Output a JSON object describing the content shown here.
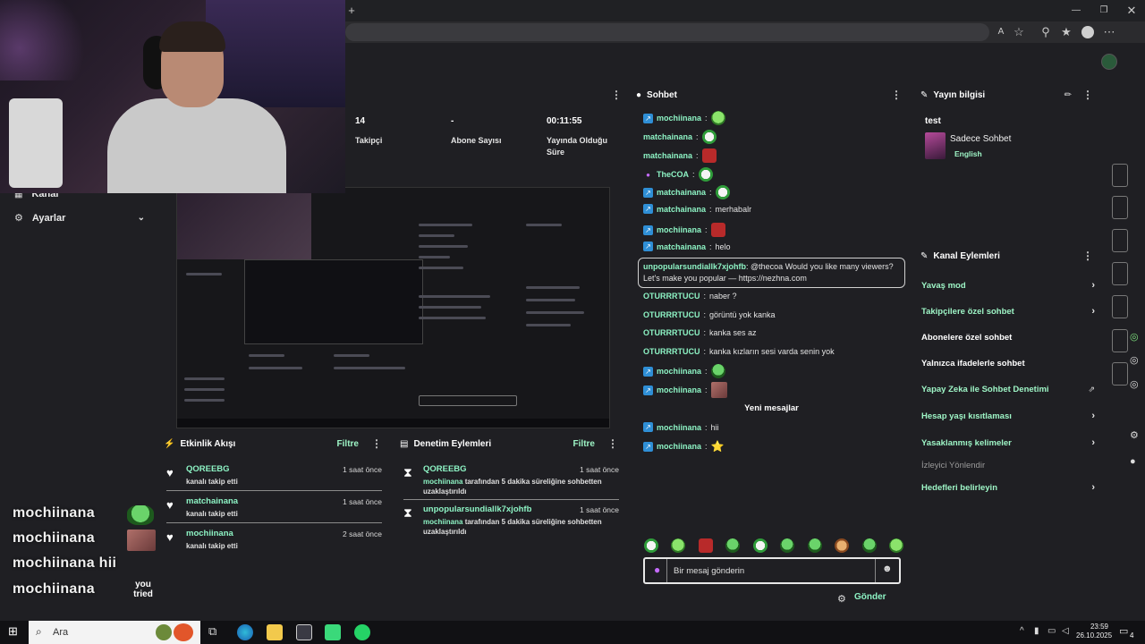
{
  "browser": {
    "new_tab_icon": "plus-icon",
    "window_controls": [
      "minimize-icon",
      "restore-icon",
      "close-icon"
    ]
  },
  "nav": {
    "kanal_label": "Kanal",
    "ayarlar_label": "Ayarlar"
  },
  "stats": {
    "panel_kebab": "⋮",
    "items": [
      {
        "value": "14",
        "label": "Takipçi"
      },
      {
        "value": "-",
        "label": "Abone Sayısı"
      },
      {
        "value": "00:11:55",
        "label": "Yayında Olduğu Süre"
      }
    ]
  },
  "activity": {
    "title": "Etkinlik Akışı",
    "filter": "Filtre",
    "events": [
      {
        "name": "QOREEBG",
        "desc": "kanalı takip etti",
        "time": "1 saat önce"
      },
      {
        "name": "matchainana",
        "desc": "kanalı takip etti",
        "time": "1 saat önce"
      },
      {
        "name": "mochiinana",
        "desc": "kanalı takip etti",
        "time": "2 saat önce"
      }
    ]
  },
  "moderation": {
    "title": "Denetim Eylemleri",
    "filter": "Filtre",
    "events": [
      {
        "name": "QOREEBG",
        "actor": "mochiinana",
        "desc": "tarafından 5 dakika süreliğine sohbetten uzaklaştırıldı",
        "time": "1 saat önce"
      },
      {
        "name": "unpopularsundiallk7xjohfb",
        "actor": "mochiinana",
        "desc": "tarafından 5 dakika süreliğine sohbetten uzaklaştırıldı",
        "time": "1 saat önce"
      }
    ]
  },
  "chat": {
    "title": "Sohbet",
    "messages": [
      {
        "user": "mochiinana",
        "text": "",
        "emote": "frog",
        "badge": "blue"
      },
      {
        "user": "matchainana",
        "text": "",
        "emote": "white",
        "badge": ""
      },
      {
        "user": "matchainana",
        "text": "",
        "emote": "red",
        "badge": ""
      },
      {
        "user": "TheCOA",
        "text": "",
        "emote": "white",
        "badge": "mic"
      },
      {
        "user": "matchainana",
        "text": "",
        "emote": "white",
        "badge": "blue"
      },
      {
        "user": "matchainana",
        "text": "merhabalr",
        "emote": "",
        "badge": "blue"
      },
      {
        "user": "mochiinana",
        "text": "",
        "emote": "red",
        "badge": "blue"
      },
      {
        "user": "matchainana",
        "text": "helo",
        "emote": "",
        "badge": "blue"
      }
    ],
    "highlight": {
      "user": "unpopularsundiallk7xjohfb",
      "text": "@thecoa Would you like many viewers? Let's make you popular — https://nezhna.com"
    },
    "messages2": [
      {
        "user": "OTURRRTUCU",
        "text": "naber ?"
      },
      {
        "user": "OTURRRTUCU",
        "text": "görüntü yok kanka"
      },
      {
        "user": "OTURRRTUCU",
        "text": "kanka ses az"
      },
      {
        "user": "OTURRRTUCU",
        "text": "kanka kızların sesi varda senin yok"
      }
    ],
    "messages3": [
      {
        "user": "mochiinana",
        "emote": "pepe"
      },
      {
        "user": "mochiinana",
        "emote": "photo"
      }
    ],
    "new_messages": "Yeni mesajlar",
    "messages4": [
      {
        "user": "mochiinana",
        "text": "hii"
      },
      {
        "user": "mochiinana",
        "text": "⭐"
      }
    ],
    "input_placeholder": "Bir mesaj gönderin",
    "send_label": "Gönder"
  },
  "stream_info": {
    "title": "Yayın bilgisi",
    "stream_title": "test",
    "category": "Sadece Sohbet",
    "language": "English"
  },
  "channel_actions": {
    "title": "Kanal Eylemleri",
    "items": [
      {
        "label": "Yavaş mod",
        "style": "green",
        "chev": true
      },
      {
        "label": "Takipçilere özel sohbet",
        "style": "green",
        "chev": true
      },
      {
        "label": "Abonelere özel sohbet",
        "style": "white",
        "chev": false
      },
      {
        "label": "Yalnızca ifadelerle sohbet",
        "style": "white",
        "chev": false
      },
      {
        "label": "Yapay Zeka ile Sohbet Denetimi",
        "style": "green",
        "chev": false
      },
      {
        "label": "Hesap yaşı kısıtlaması",
        "style": "green",
        "chev": true
      },
      {
        "label": "Yasaklanmış kelimeler",
        "style": "green",
        "chev": true
      },
      {
        "label": "İzleyici Yönlendir",
        "style": "grey",
        "chev": false
      },
      {
        "label": "Hedefleri belirleyin",
        "style": "green",
        "chev": true
      }
    ]
  },
  "overlay": {
    "alerts": [
      {
        "user": "mochiinana",
        "text": ""
      },
      {
        "user": "mochiinana",
        "text": ""
      },
      {
        "user": "mochiinana",
        "text": "hii"
      },
      {
        "user": "mochiinana",
        "text": ""
      }
    ],
    "emote_text": "you tried"
  },
  "taskbar": {
    "search_placeholder": "Ara",
    "time": "23:59",
    "date": "26.10.2025",
    "notification_count": "4"
  }
}
